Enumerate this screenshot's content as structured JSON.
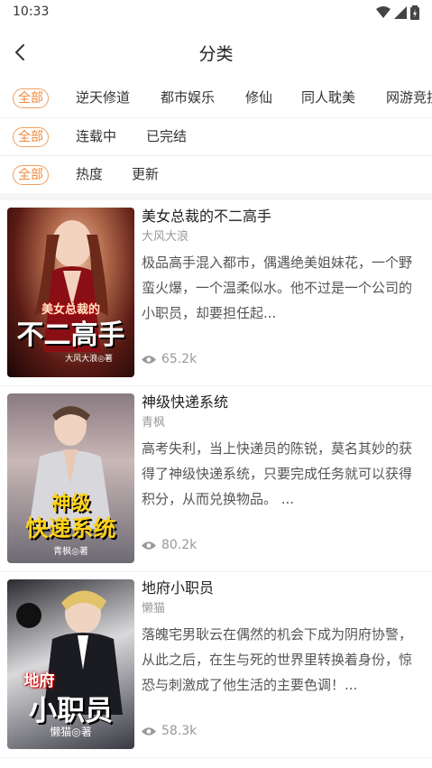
{
  "status_bar": {
    "time": "10:33"
  },
  "header": {
    "title": "分类"
  },
  "filters": {
    "row1": [
      "全部",
      "逆天修道",
      "都市娱乐",
      "修仙",
      "同人耽美",
      "网游竞技"
    ],
    "row2": [
      "全部",
      "连载中",
      "已完结"
    ],
    "row3": [
      "全部",
      "热度",
      "更新"
    ]
  },
  "colors": {
    "accent": "#f08a3c"
  },
  "books": [
    {
      "title": "美女总裁的不二高手",
      "author": "大风大浪",
      "description": "极品高手混入都市，偶遇绝美姐妹花，一个野蛮火爆，一个温柔似水。他不过是一个公司的小职员，却要担任起...",
      "views": "65.2k",
      "cover_small": "美女总裁的",
      "cover_big": "不二高手",
      "cover_author": "大风大浪◎著"
    },
    {
      "title": "神级快递系统",
      "author": "青枫",
      "description": "高考失利，当上快递员的陈锐，莫名其妙的获得了神级快递系统，只要完成任务就可以获得积分，从而兑换物品。 ...",
      "views": "80.2k",
      "cover_small": "神级",
      "cover_big": "快递系统",
      "cover_author": "青枫◎著"
    },
    {
      "title": "地府小职员",
      "author": "懒猫",
      "description": "落魄宅男耿云在偶然的机会下成为阴府协警，从此之后，在生与死的世界里转换着身份，惊恐与刺激成了他生活的主要色调！...",
      "views": "58.3k",
      "cover_small": "地府",
      "cover_big": "小职员",
      "cover_author": "懒猫◎著"
    }
  ]
}
